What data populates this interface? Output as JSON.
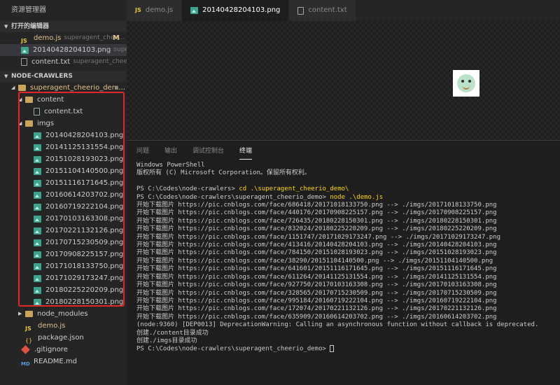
{
  "sidebar": {
    "title": "资源管理器",
    "open_editors": {
      "header": "打开的编辑器",
      "items": [
        {
          "name": "demo.js",
          "path": "superagent_chee...",
          "mark": "M"
        },
        {
          "name": "20140428204103.png",
          "path": "supera..."
        },
        {
          "name": "content.txt",
          "path": "superagent_cheeri..."
        }
      ]
    },
    "project": {
      "header": "NODE-CRAWLERS",
      "root_folder": "superagent_cheerio_dem...",
      "content_folder": "content",
      "content_file": "content.txt",
      "imgs_folder": "imgs",
      "images": [
        "20140428204103.png",
        "20141125131554.png",
        "20151028193023.png",
        "20151104140500.png",
        "20151116171645.png",
        "20160614203702.png",
        "20160719222104.png",
        "20170103163308.png",
        "20170221132126.png",
        "20170715230509.png",
        "20170908225157.png",
        "20171018133750.png",
        "20171029173247.png",
        "20180225220209.png",
        "20180228150301.png"
      ],
      "node_modules": "node_modules",
      "demo_js": "demo.js",
      "package_json": "package.json",
      "gitignore": ".gitignore",
      "readme": "README.md"
    }
  },
  "tabs": [
    {
      "label": "demo.js"
    },
    {
      "label": "20140428204103.png"
    },
    {
      "label": "content.txt"
    }
  ],
  "panel": {
    "tabs": [
      "问题",
      "输出",
      "调试控制台",
      "终端"
    ]
  },
  "terminal": {
    "header1": "Windows PowerShell",
    "header2": "版权所有 (C) Microsoft Corporation。保留所有权利。",
    "prompt1": "PS C:\\Codes\\node-crawlers> ",
    "cmd1": "cd .\\superagent_cheerio_demo\\",
    "prompt2": "PS C:\\Codes\\node-crawlers\\superagent_cheerio_demo> ",
    "cmd2": "node .\\demo.js",
    "downloads": [
      "开始下载图片 https://pic.cnblogs.com/face/686418/20171018133750.png --> ./imgs/20171018133750.png",
      "开始下载图片 https://pic.cnblogs.com/face/440176/20170908225157.png --> ./imgs/20170908225157.png",
      "开始下载图片 https://pic.cnblogs.com/face/726435/20180228150301.png --> ./imgs/20180228150301.png",
      "开始下载图片 https://pic.cnblogs.com/face/832024/20180225220209.png --> ./imgs/20180225220209.png",
      "开始下载图片 https://pic.cnblogs.com/face/1151747/20171029173247.png --> ./imgs/20171029173247.png",
      "开始下载图片 https://pic.cnblogs.com/face/413416/20140428204103.png --> ./imgs/20140428204103.png",
      "开始下载图片 https://pic.cnblogs.com/face/784150/20151028193023.png --> ./imgs/20151028193023.png",
      "开始下载图片 https://pic.cnblogs.com/face/38290/20151104140500.png --> ./imgs/20151104140500.png",
      "开始下载图片 https://pic.cnblogs.com/face/641601/20151116171645.png --> ./imgs/20151116171645.png",
      "开始下载图片 https://pic.cnblogs.com/face/611264/20141125131554.png --> ./imgs/20141125131554.png",
      "开始下载图片 https://pic.cnblogs.com/face/927750/20170103163308.png --> ./imgs/20170103163308.png",
      "开始下载图片 https://pic.cnblogs.com/face/328565/20170715230509.png --> ./imgs/20170715230509.png",
      "开始下载图片 https://pic.cnblogs.com/face/995184/20160719222104.png --> ./imgs/20160719222104.png",
      "开始下载图片 https://pic.cnblogs.com/face/172074/20170221132126.png --> ./imgs/20170221132126.png",
      "开始下载图片 https://pic.cnblogs.com/face/635909/20160614203702.png --> ./imgs/20160614203702.png"
    ],
    "warning": "(node:9360) [DEP0013] DeprecationWarning: Calling an asynchronous function without callback is deprecated.",
    "created1": "创建./content目录成功",
    "created2": "创建./imgs目录成功",
    "prompt3": "PS C:\\Codes\\node-crawlers\\superagent_cheerio_demo> "
  }
}
